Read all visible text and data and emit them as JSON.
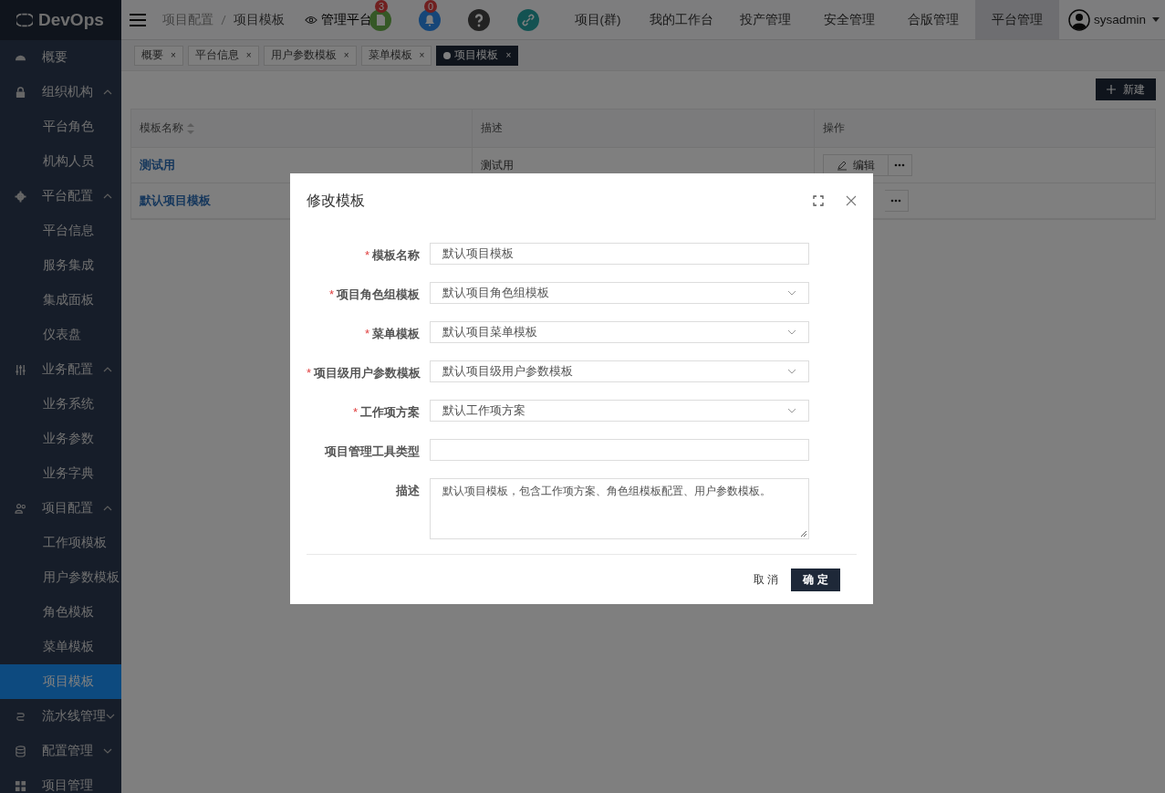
{
  "app": {
    "logo": "DevOps"
  },
  "sidebar": {
    "items": [
      {
        "label": "概要",
        "kind": "link",
        "selected": false
      },
      {
        "label": "组织机构",
        "kind": "group",
        "expanded": true,
        "children": [
          {
            "label": "平台角色",
            "selected": false
          },
          {
            "label": "机构人员",
            "selected": false
          }
        ]
      },
      {
        "label": "平台配置",
        "kind": "group",
        "expanded": true,
        "children": [
          {
            "label": "平台信息",
            "selected": false
          },
          {
            "label": "服务集成",
            "selected": false
          },
          {
            "label": "集成面板",
            "selected": false
          },
          {
            "label": "仪表盘",
            "selected": false
          }
        ]
      },
      {
        "label": "业务配置",
        "kind": "group",
        "expanded": true,
        "children": [
          {
            "label": "业务系统",
            "selected": false
          },
          {
            "label": "业务参数",
            "selected": false
          },
          {
            "label": "业务字典",
            "selected": false
          }
        ]
      },
      {
        "label": "项目配置",
        "kind": "group",
        "expanded": true,
        "children": [
          {
            "label": "工作项模板",
            "selected": false
          },
          {
            "label": "用户参数模板",
            "selected": false
          },
          {
            "label": "角色模板",
            "selected": false
          },
          {
            "label": "菜单模板",
            "selected": false
          },
          {
            "label": "项目模板",
            "selected": true
          }
        ]
      },
      {
        "label": "流水线管理",
        "kind": "group",
        "expanded": false
      },
      {
        "label": "配置管理",
        "kind": "group",
        "expanded": false
      },
      {
        "label": "项目管理",
        "kind": "link",
        "selected": false
      }
    ]
  },
  "header": {
    "breadcrumb": [
      "项目配置",
      "项目模板"
    ],
    "mode": "管理平台",
    "badges": [
      "3",
      "0"
    ],
    "nav": [
      {
        "label": "项目(群)",
        "selected": false
      },
      {
        "label": "我的工作台",
        "selected": false
      },
      {
        "label": "投产管理",
        "selected": false
      },
      {
        "label": "安全管理",
        "selected": false
      },
      {
        "label": "合版管理",
        "selected": false
      },
      {
        "label": "平台管理",
        "selected": true
      }
    ],
    "user": "sysadmin"
  },
  "tabs": [
    {
      "label": "概要",
      "close": "×",
      "selected": false
    },
    {
      "label": "平台信息",
      "close": "×",
      "selected": false
    },
    {
      "label": "用户参数模板",
      "close": "×",
      "selected": false
    },
    {
      "label": "菜单模板",
      "close": "×",
      "selected": false
    },
    {
      "label": "项目模板",
      "close": "×",
      "selected": true
    }
  ],
  "toolbar": {
    "new_button": "新建"
  },
  "table": {
    "columns": [
      {
        "label": "模板名称",
        "sortable": true
      },
      {
        "label": "描述",
        "sortable": false
      },
      {
        "label": "操作",
        "sortable": false
      }
    ],
    "rows": [
      {
        "name": "测试用",
        "description": "测试用",
        "edit": "编辑"
      },
      {
        "name": "默认项目模板"
      }
    ]
  },
  "dialog": {
    "title": "修改模板",
    "fields": [
      {
        "label": "模板名称",
        "required_mark": "*",
        "kind": "input",
        "value": "默认项目模板"
      },
      {
        "label": "项目角色组模板",
        "required_mark": "*",
        "kind": "select",
        "value": "默认项目角色组模板"
      },
      {
        "label": "菜单模板",
        "required_mark": "*",
        "kind": "select",
        "value": "默认项目菜单模板"
      },
      {
        "label": "项目级用户参数模板",
        "required_mark": "*",
        "kind": "select",
        "value": "默认项目级用户参数模板"
      },
      {
        "label": "工作项方案",
        "required_mark": "*",
        "kind": "select",
        "value": "默认工作项方案"
      },
      {
        "label": "项目管理工具类型",
        "kind": "input"
      },
      {
        "label": "描述",
        "kind": "textarea",
        "value": "默认项目模板，包含工作项方案、角色组模板配置、用户参数模板。"
      }
    ],
    "cancel": "取 消",
    "ok": "确 定"
  }
}
